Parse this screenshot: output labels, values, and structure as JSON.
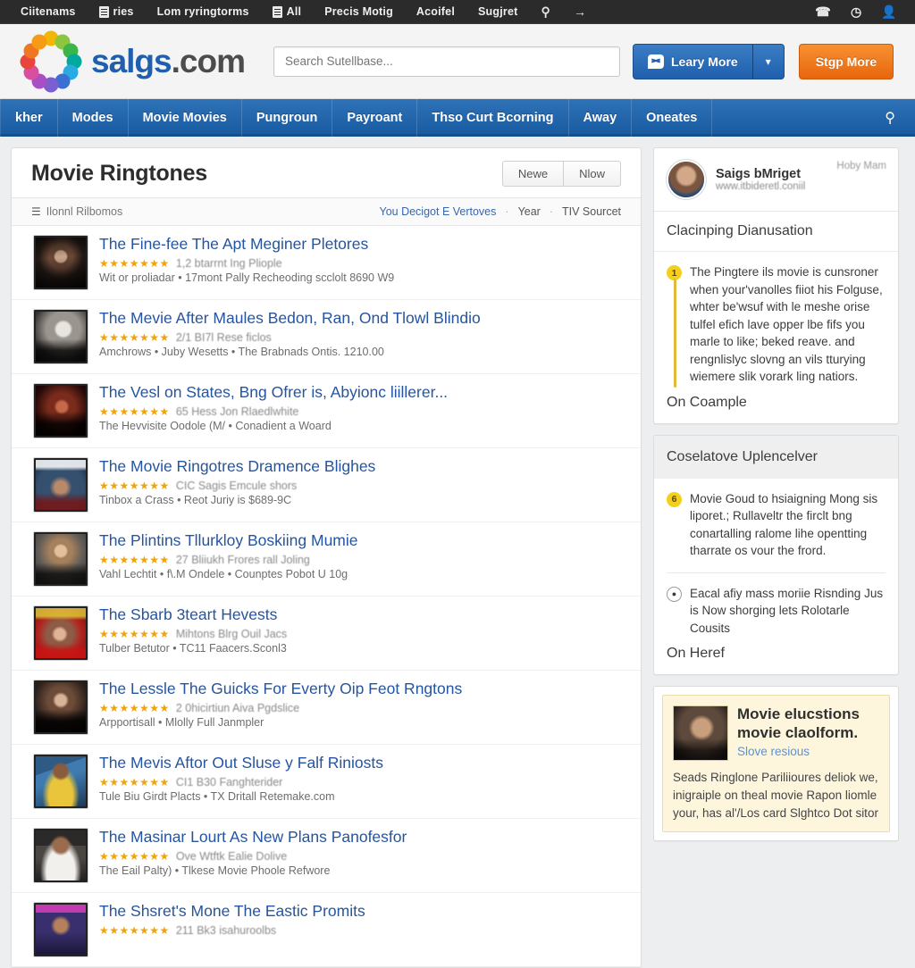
{
  "topbar": {
    "items": [
      {
        "label": "Ciitenams",
        "icon": "none"
      },
      {
        "label": "ries",
        "icon": "doc-icon"
      },
      {
        "label": "Lom ryringtorms",
        "icon": "none"
      },
      {
        "label": "All",
        "icon": "doc-icon"
      },
      {
        "label": "Precis Motig",
        "icon": "none"
      },
      {
        "label": "Acoifel",
        "icon": "none"
      },
      {
        "label": "Sugjret",
        "icon": "none"
      }
    ],
    "left_glyphs": [
      "search-icon",
      "arrow-right-icon"
    ],
    "right_glyphs": [
      "phone-icon",
      "clock-icon",
      "user-icon"
    ]
  },
  "masthead": {
    "logo_primary": "salgs",
    "logo_suffix": ".com",
    "search_placeholder": "Search Sutellbase...",
    "search_value": "",
    "learn_more_label": "Leary More",
    "caret_label": "∨",
    "sign_more_label": "Stgp More"
  },
  "mainnav": {
    "items": [
      "kher",
      "Modes",
      "Movie Movies",
      "Pungroun",
      "Payroant",
      "Thso Curt Bcorning",
      "Away",
      "Oneates"
    ],
    "search_glyph": "search-icon"
  },
  "panel": {
    "title": "Movie Ringtones",
    "segmented": [
      "Newe",
      "Nlow"
    ],
    "filter_left_icon": "sort-icon",
    "filter_left_label": "Ilonnl Rilbomos",
    "filter_links": [
      "You Decigot E Vertoves",
      "Year",
      "TIV Sourcet"
    ],
    "filter_separator": "·"
  },
  "results": [
    {
      "title": "The Fine-fee The Apt Meginer Pletores",
      "stars": 7,
      "rating_text": "1,2 btarrnt Ing Pliople",
      "sub": "Wit or proliadar • 17mont Pally Recheoding scclolt 8690 W9",
      "thumb": "portrait-woman-dark"
    },
    {
      "title": "The Mevie After Maules Bedon, Ran, Ond Tlowl Blindio",
      "stars": 7,
      "rating_text": "2/1 BI7l Rese ficlos",
      "sub": "Amchrows • Juby Wesetts • The Brabnads Ontis. 1210.00",
      "thumb": "portrait-woman-bw"
    },
    {
      "title": "The Vesl on States, Bng Ofrer is, Abyionc liillerer...",
      "stars": 7,
      "rating_text": "65 Hess Jon Rlaedlwhite",
      "sub": "The Hevvisite Oodole (M/ • Conadient a Woard",
      "thumb": "poster-red-dark"
    },
    {
      "title": "The Movie Ringotres Dramence Blighes",
      "stars": 7,
      "rating_text": "CIC Sagis Emcule shors",
      "sub": "Tinbox a Crass • Reot Juriy is $689-9C",
      "thumb": "poster-blue-man"
    },
    {
      "title": "The Plintins Tllurkloy Boskiing Mumie",
      "stars": 7,
      "rating_text": "27 Bliiukh Frores rall Joling",
      "sub": "Vahl Lechtit • f\\.M Ondele • Counptes Pobot U 10g",
      "thumb": "portrait-blonde"
    },
    {
      "title": "The Sbarb 3teart Hevests",
      "stars": 7,
      "rating_text": "Mihtons Blrg Ouil Jacs",
      "sub": "Tulber Betutor • TC11 Faacers.Sconl3",
      "thumb": "poster-magazine-red"
    },
    {
      "title": "The Lessle The Guicks For Everty Oip Feot Rngtons",
      "stars": 7,
      "rating_text": "2 0hicirtiun Aiva Pgdslice",
      "sub": "Arpportisall • Mlolly Full Janmpler",
      "thumb": "portrait-dark-hair"
    },
    {
      "title": "The Mevis Aftor Out Sluse y Falf Riniosts",
      "stars": 7,
      "rating_text": "CI1 B30 Fanghterider",
      "sub": "Tule Biu Girdt Placts • TX Dritall Retemake.com",
      "thumb": "photo-yellow-jersey"
    },
    {
      "title": "The Masinar Lourt As New Plans Panofesfor",
      "stars": 7,
      "rating_text": "Ove Wtftk Ealie Dolive",
      "sub": "The Eail Palty) • Tlkese Movie Phoole Refwore",
      "thumb": "photo-white-shirt"
    },
    {
      "title": "The Shsret's Mone The Eastic Promits",
      "stars": 7,
      "rating_text": "211 Bk3 isahuroolbs",
      "sub": "",
      "thumb": "photo-stage-purple"
    }
  ],
  "sidebar": {
    "profile": {
      "name": "Saigs bMriget",
      "url": "www.itbideretl.coniil",
      "corner_label": "Hoby Mam",
      "avatar": "user-photo"
    },
    "card1": {
      "heading": "Clacinping Dianusation",
      "tip_badge": "1",
      "tip_text": "The Pingtere ils movie is cunsroner when your'vanolles fiiot his Folguse, whter be'wsuf with le meshe orise tulfel efich lave opper lbe fifs you marle to like; beked reave. and rengnlislyc slovng an vils tturying wiemere slik vorark ling natiors.",
      "footer": "On Coample"
    },
    "card2": {
      "heading": "Coselatove Uplencelver",
      "tip1_badge": "6",
      "tip1_text": "Movie Goud to hsiaigning Mong sis liporet.; Rullaveltr the firclt bng conartalling ralome lihe opentting tharrate os vour the frord.",
      "tip2_badge": "●",
      "tip2_text": "Eacal afiy mass moriie Risnding Jus is Now shorging lets Rolotarle Cousits",
      "footer": "On Heref"
    },
    "promo": {
      "title": "Movie elucstions movie claolform.",
      "link": "Slove resious",
      "body": "Seads Ringlone Pariliioures deliok we, inigraiple on theal movie Rapon liomle your, has al'/Los card Slghtco Dot sitor",
      "image": "man-portrait"
    }
  },
  "colors": {
    "nav_blue": "#18599f",
    "link_blue": "#2554a0",
    "cta_orange": "#e8660d",
    "star_gold": "#f0a30a",
    "topbar_dark": "#2b2b2b",
    "badge_yellow": "#f5cf1e"
  }
}
